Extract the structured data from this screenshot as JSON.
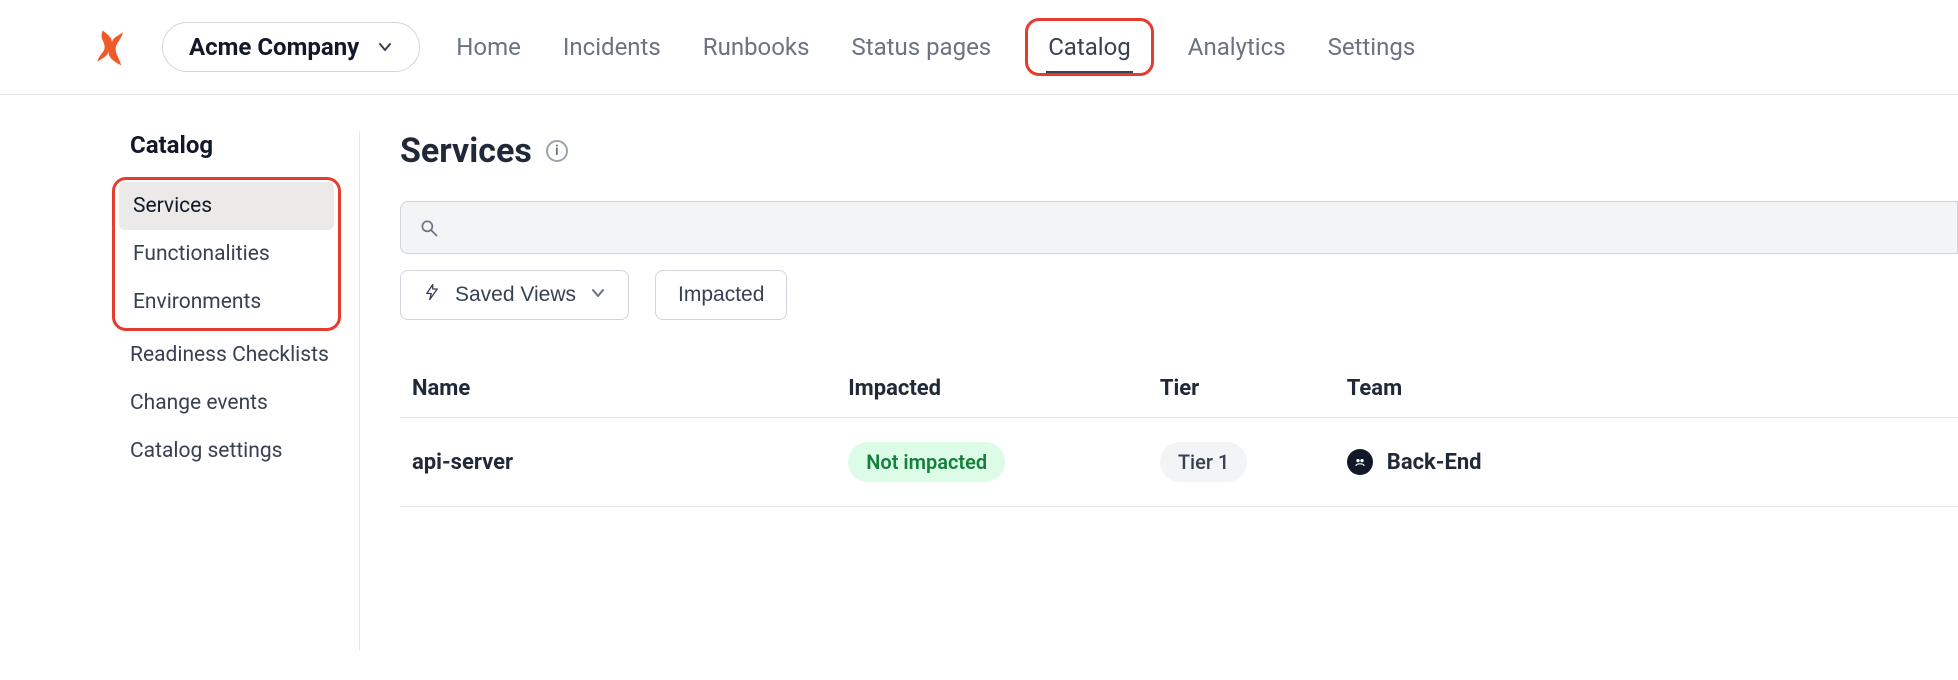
{
  "org": {
    "name": "Acme Company"
  },
  "nav": {
    "items": [
      {
        "label": "Home"
      },
      {
        "label": "Incidents"
      },
      {
        "label": "Runbooks"
      },
      {
        "label": "Status pages"
      },
      {
        "label": "Catalog",
        "active": true,
        "highlighted": true
      },
      {
        "label": "Analytics"
      },
      {
        "label": "Settings"
      }
    ]
  },
  "sidebar": {
    "title": "Catalog",
    "items": [
      {
        "label": "Services",
        "selected": true,
        "highlighted": true
      },
      {
        "label": "Functionalities",
        "highlighted": true
      },
      {
        "label": "Environments",
        "highlighted": true
      },
      {
        "label": "Readiness Checklists"
      },
      {
        "label": "Change events"
      },
      {
        "label": "Catalog settings"
      }
    ]
  },
  "page": {
    "title": "Services"
  },
  "search": {
    "value": "",
    "placeholder": ""
  },
  "filters": {
    "saved_views_label": "Saved Views",
    "impacted_label": "Impacted"
  },
  "table": {
    "columns": [
      "Name",
      "Impacted",
      "Tier",
      "Team"
    ],
    "rows": [
      {
        "name": "api-server",
        "impacted": "Not impacted",
        "tier": "Tier 1",
        "team": "Back-End"
      }
    ]
  },
  "icons": {
    "info": "i"
  }
}
